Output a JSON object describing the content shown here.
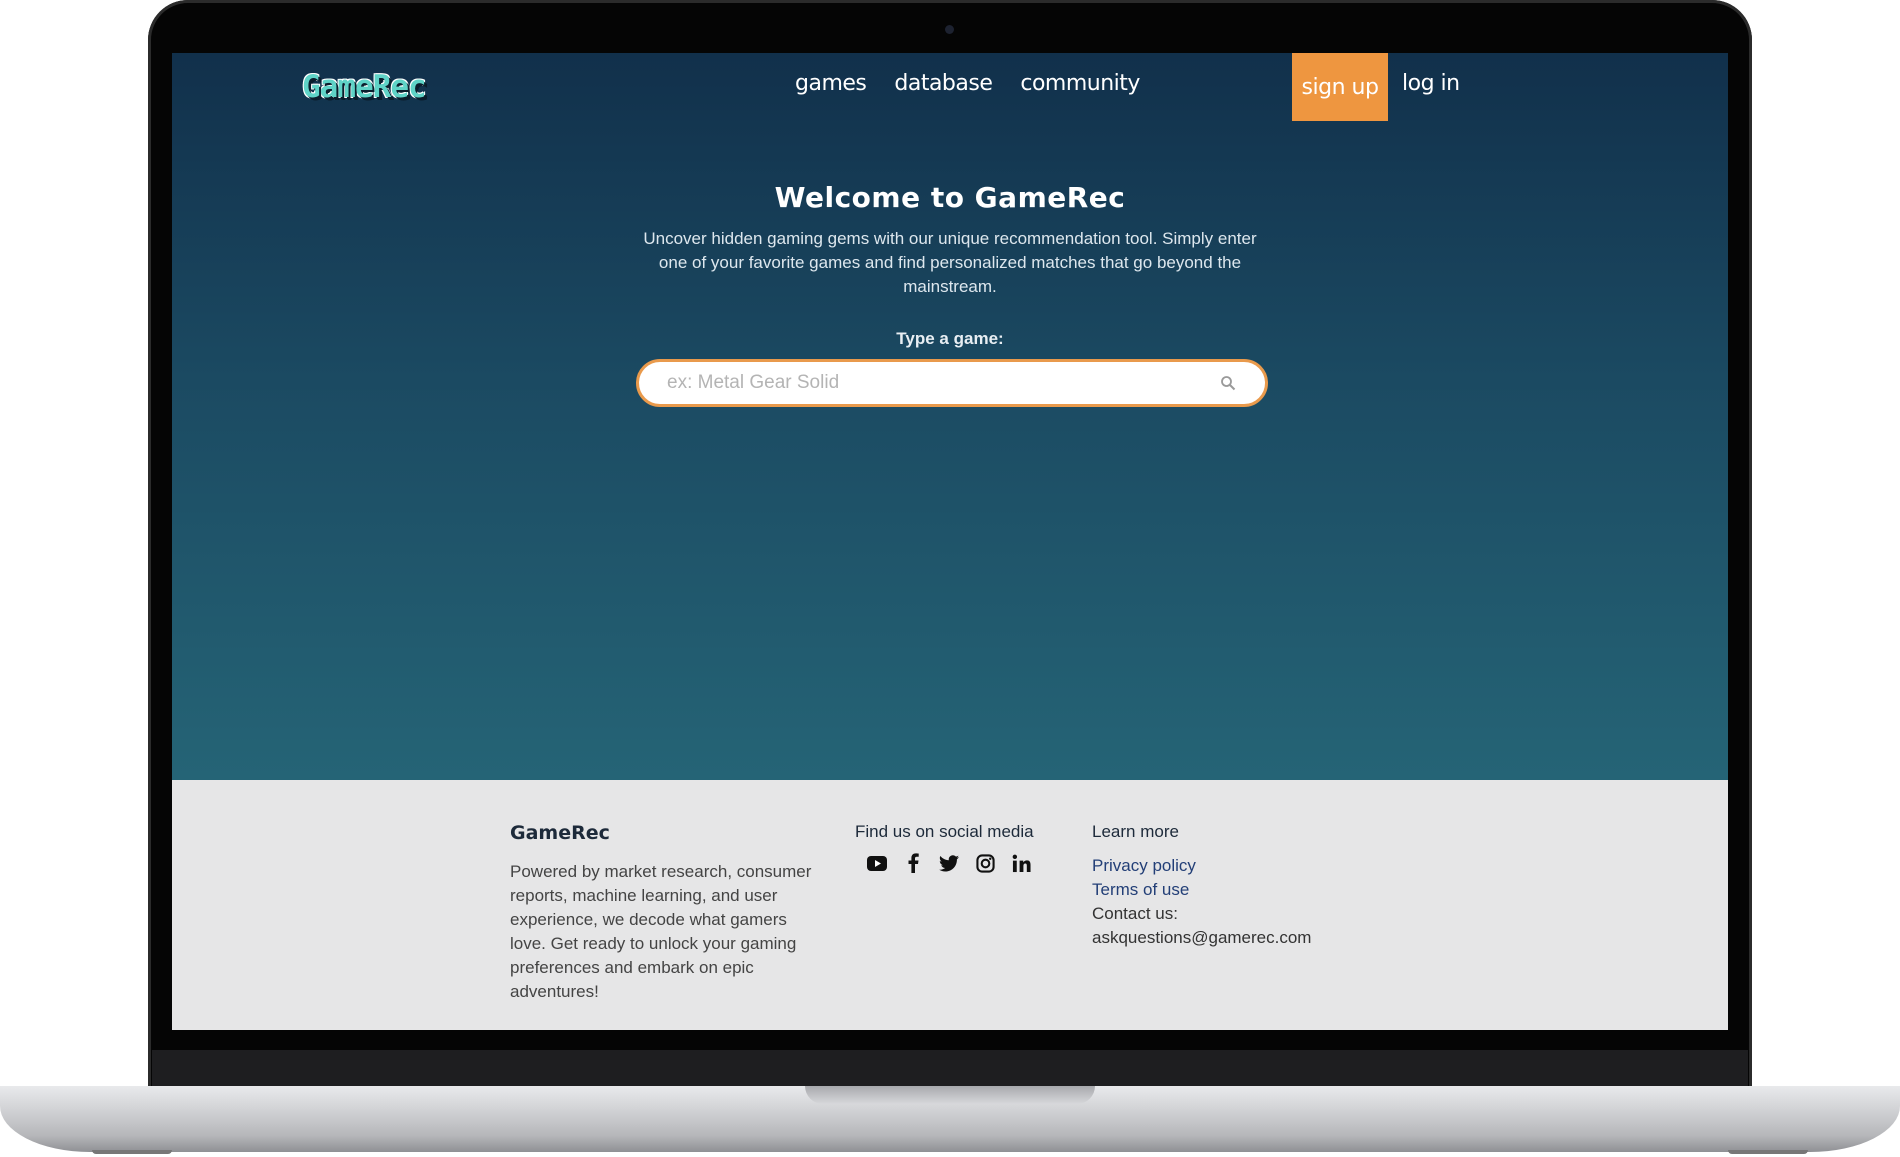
{
  "header": {
    "logo": "GameRec",
    "nav": [
      "games",
      "database",
      "community"
    ],
    "signup_label": "sign up",
    "login_label": "log in"
  },
  "hero": {
    "title": "Welcome to GameRec",
    "intro": "Uncover hidden gaming gems with our unique recommendation tool. Simply enter one of your favorite games and find personalized matches that go beyond the mainstream.",
    "search_label": "Type a game:",
    "search_placeholder": "ex: Metal Gear Solid",
    "search_value": ""
  },
  "footer": {
    "brand": "GameRec",
    "description": "Powered by market research, consumer reports, machine learning, and user experience, we decode what gamers love. Get ready to unlock your gaming preferences and embark on epic adventures!",
    "social_title": "Find us on social media",
    "social_icons": [
      "youtube-icon",
      "facebook-icon",
      "twitter-icon",
      "instagram-icon",
      "linkedin-icon"
    ],
    "learn_title": "Learn more",
    "privacy_label": "Privacy policy",
    "terms_label": "Terms of use",
    "contact_label": "Contact us:",
    "contact_email": "askquestions@gamerec.com"
  },
  "colors": {
    "accent": "#ee9640",
    "hero_top": "#11304b",
    "hero_bottom": "#256476",
    "footer_bg": "#e6e6e7",
    "link": "#233f77"
  }
}
